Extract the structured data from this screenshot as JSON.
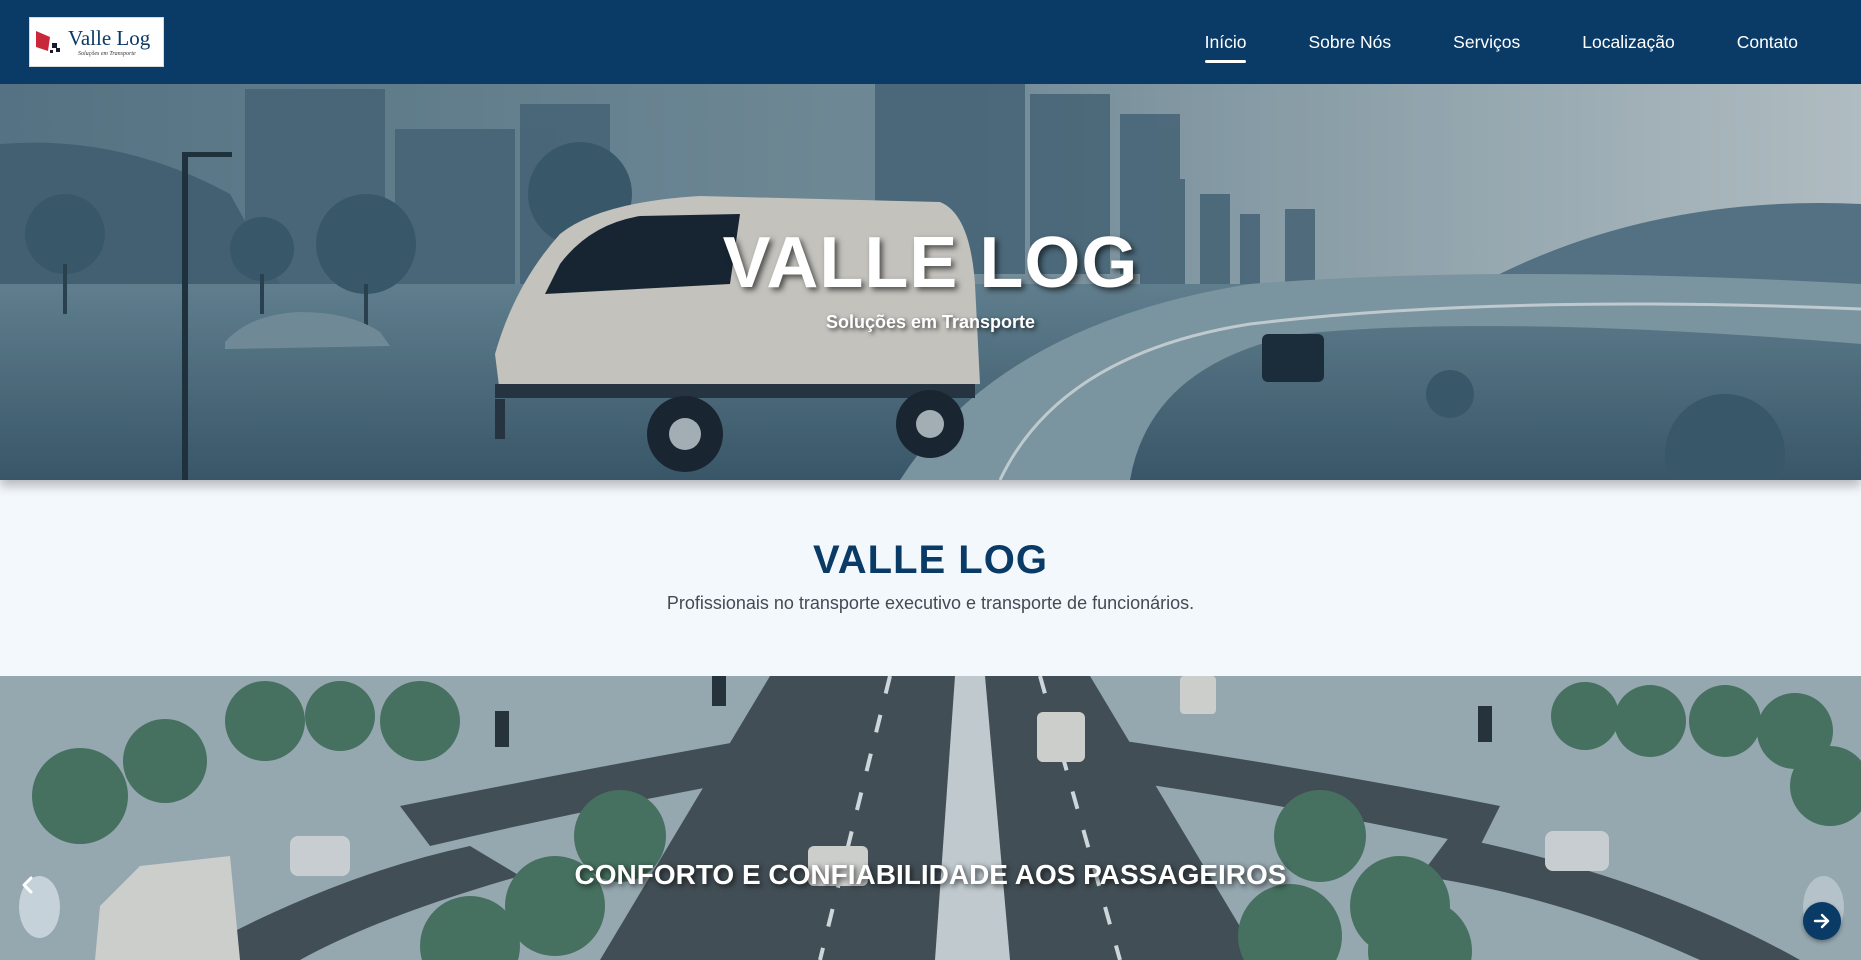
{
  "header": {
    "logo": {
      "title": "Valle Log",
      "subtitle": "Soluções em Transporte"
    },
    "nav": [
      {
        "label": "Início",
        "active": true
      },
      {
        "label": "Sobre Nós",
        "active": false
      },
      {
        "label": "Serviços",
        "active": false
      },
      {
        "label": "Localização",
        "active": false
      },
      {
        "label": "Contato",
        "active": false
      }
    ]
  },
  "hero": {
    "title": "VALLE LOG",
    "subtitle": "Soluções em Transporte"
  },
  "intro": {
    "title": "VALLE LOG",
    "text": "Profissionais no transporte executivo e transporte de funcionários."
  },
  "carousel": {
    "caption": "CONFORTO E CONFIABILIDADE AOS PASSAGEIROS",
    "prev_icon": "chevron-left-icon",
    "next_icon": "arrow-right-icon"
  },
  "colors": {
    "primary": "#0a3a66",
    "background": "#f3f8fd",
    "text": "#444a52"
  }
}
